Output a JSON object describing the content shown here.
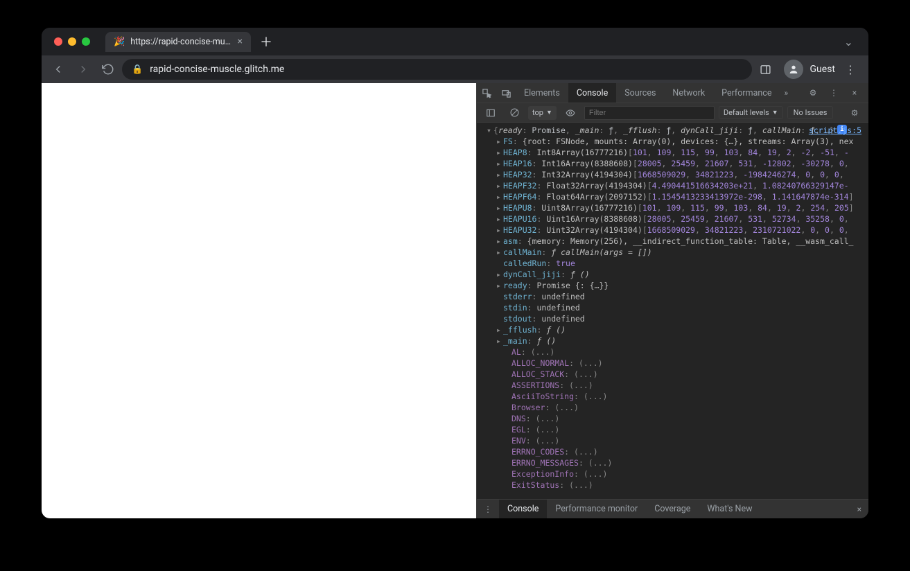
{
  "tab": {
    "title": "https://rapid-concise-muscle.g",
    "favicon": "🎉"
  },
  "url": "rapid-concise-muscle.glitch.me",
  "guest_label": "Guest",
  "devtools": {
    "tabs": [
      "Elements",
      "Console",
      "Sources",
      "Network",
      "Performance"
    ],
    "active_tab": "Console",
    "context": "top",
    "filter_placeholder": "Filter",
    "levels": "Default levels",
    "issues": "No Issues",
    "source": "script.js:5",
    "drawer_tabs": [
      "Console",
      "Performance monitor",
      "Coverage",
      "What's New"
    ],
    "active_drawer": "Console"
  },
  "obj": {
    "summary_parts": [
      {
        "k": "ready",
        "v": "Promise"
      },
      {
        "k": "_main",
        "v": "ƒ"
      },
      {
        "k": "_fflush",
        "v": "ƒ"
      },
      {
        "k": "dynCall_jiji",
        "v": "ƒ"
      },
      {
        "k": "callMain",
        "v": "ƒ"
      }
    ],
    "lines": [
      {
        "key": "FS",
        "plain": "{root: FSNode, mounts: Array(0), devices: {…}, streams: Array(3), nex",
        "arrow": true
      },
      {
        "key": "HEAP8",
        "label": "Int8Array(16777216)",
        "nums": [
          101,
          109,
          115,
          99,
          103,
          84,
          19,
          2,
          -2,
          -51,
          "-"
        ],
        "arrow": true
      },
      {
        "key": "HEAP16",
        "label": "Int16Array(8388608)",
        "nums": [
          28005,
          25459,
          21607,
          531,
          -12802,
          -30278,
          0,
          ""
        ],
        "arrow": true
      },
      {
        "key": "HEAP32",
        "label": "Int32Array(4194304)",
        "nums": [
          1668509029,
          34821223,
          -1984246274,
          0,
          0,
          0,
          ""
        ],
        "arrow": true
      },
      {
        "key": "HEAPF32",
        "label": "Float32Array(4194304)",
        "nums": [
          "4.490441516634203e+21",
          "1.08240766329147e-"
        ],
        "arrow": true
      },
      {
        "key": "HEAPF64",
        "label": "Float64Array(2097152)",
        "nums": [
          "1.1545413233413972e-298",
          "1.141647874e-314"
        ],
        "arrow": true
      },
      {
        "key": "HEAPU8",
        "label": "Uint8Array(16777216)",
        "nums": [
          101,
          109,
          115,
          99,
          103,
          84,
          19,
          2,
          254,
          205
        ],
        "arrow": true
      },
      {
        "key": "HEAPU16",
        "label": "Uint16Array(8388608)",
        "nums": [
          28005,
          25459,
          21607,
          531,
          52734,
          35258,
          0,
          ""
        ],
        "arrow": true
      },
      {
        "key": "HEAPU32",
        "label": "Uint32Array(4194304)",
        "nums": [
          1668509029,
          34821223,
          2310721022,
          0,
          0,
          0,
          ""
        ],
        "arrow": true
      },
      {
        "key": "asm",
        "plain": "{memory: Memory(256), __indirect_function_table: Table, __wasm_call_",
        "arrow": true
      },
      {
        "key": "callMain",
        "fn": "callMain(args = [])",
        "arrow": true
      },
      {
        "key": "calledRun",
        "bool": "true"
      },
      {
        "key": "dynCall_jiji",
        "fn": "()",
        "arrow": true
      },
      {
        "key": "ready",
        "plain": "Promise {<fulfilled>: {…}}",
        "arrow": true
      },
      {
        "key": "stderr",
        "undef": "undefined"
      },
      {
        "key": "stdin",
        "undef": "undefined"
      },
      {
        "key": "stdout",
        "undef": "undefined"
      },
      {
        "key": "_fflush",
        "fn": "()",
        "arrow": true
      },
      {
        "key": "_main",
        "fn": "()",
        "arrow": true
      }
    ],
    "dim": [
      "AL",
      "ALLOC_NORMAL",
      "ALLOC_STACK",
      "ASSERTIONS",
      "AsciiToString",
      "Browser",
      "DNS",
      "EGL",
      "ENV",
      "ERRNO_CODES",
      "ERRNO_MESSAGES",
      "ExceptionInfo",
      "ExitStatus"
    ]
  }
}
